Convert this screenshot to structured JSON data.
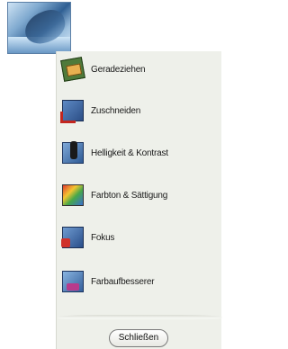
{
  "tools": [
    {
      "label": "Geradeziehen",
      "icon": "straighten-icon"
    },
    {
      "label": "Zuschneiden",
      "icon": "crop-icon"
    },
    {
      "label": "Helligkeit & Kontrast",
      "icon": "brightness-contrast-icon"
    },
    {
      "label": "Farbton & Sättigung",
      "icon": "hue-saturation-icon"
    },
    {
      "label": "Fokus",
      "icon": "focus-icon"
    },
    {
      "label": "Farbaufbesserer",
      "icon": "color-enhancer-icon"
    }
  ],
  "close_button": {
    "label": "Schließen"
  }
}
